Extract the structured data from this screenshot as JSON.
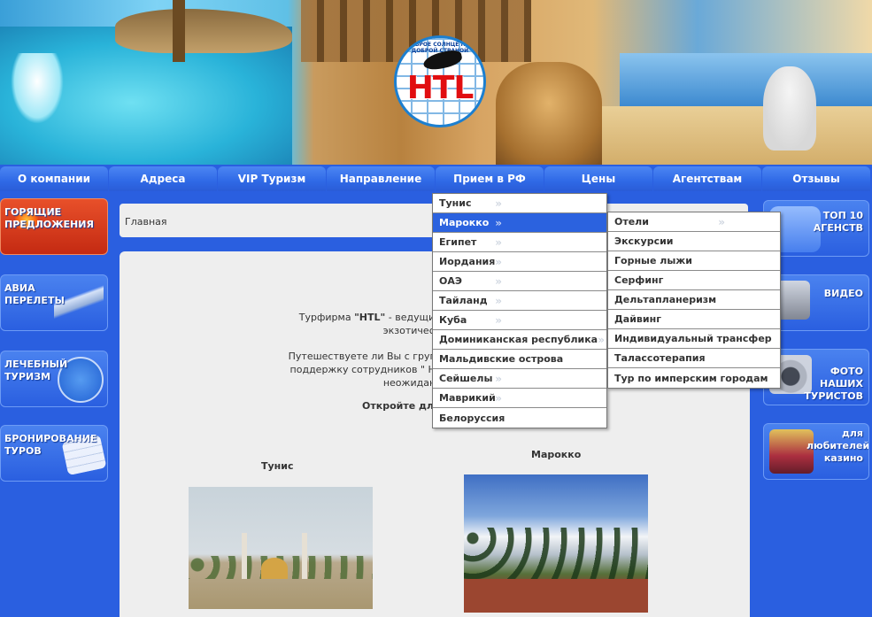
{
  "logo": {
    "text": "HTL",
    "ring_text": "ДОБРОЕ СОЛНЦЕ НАД ДОБРОЙ СТРАНОЙ"
  },
  "nav": {
    "items": [
      {
        "label": "О компании"
      },
      {
        "label": "Адреса"
      },
      {
        "label": "VIP Туризм"
      },
      {
        "label": "Направление"
      },
      {
        "label": "Прием в РФ"
      },
      {
        "label": "Цены"
      },
      {
        "label": "Агентствам"
      },
      {
        "label": "Отзывы"
      }
    ]
  },
  "left_promos": [
    {
      "title": "ГОРЯЩИЕ ПРЕДЛОЖЕНИЯ"
    },
    {
      "title": "АВИА ПЕРЕЛЕТЫ"
    },
    {
      "title": "ЛЕЧЕБНЫЙ ТУРИЗМ"
    },
    {
      "title": "БРОНИРОВАНИЕ ТУРОВ"
    }
  ],
  "right_promos": [
    {
      "title": "ТОП 10 АГЕНСТВ"
    },
    {
      "title": "ВИДЕО"
    },
    {
      "title": "ФОТО НАШИХ ТУРИСТОВ"
    },
    {
      "title": "для любителей казино"
    }
  ],
  "breadcrumb": {
    "text": "Главная"
  },
  "content": {
    "intro_line1_prefix": "Турфирма ",
    "intro_brand": "\"HTL\"",
    "intro_line1_suffix": " - ведущий тур оператор по Тунису,",
    "intro_line1b": "экзотических напра",
    "intro_line2a": "Путешествуете ли Вы с группой или индивидуально, Вы",
    "intro_line2b": "поддержку сотрудников \" HTL\". Доверив нам свой отды",
    "intro_line2c": "неожиданностей во",
    "intro_line3": "Откройте для себя новые",
    "destinations": [
      {
        "title": "Тунис"
      },
      {
        "title": "Марокко"
      }
    ]
  },
  "menu": {
    "items": [
      {
        "label": "Тунис",
        "arrow": "»"
      },
      {
        "label": "Марокко",
        "arrow": "»"
      },
      {
        "label": "Египет",
        "arrow": "»"
      },
      {
        "label": "Иордания",
        "arrow": "»"
      },
      {
        "label": "ОАЭ",
        "arrow": "»"
      },
      {
        "label": "Тайланд",
        "arrow": "»"
      },
      {
        "label": "Куба",
        "arrow": "»"
      },
      {
        "label": "Доминиканская республика",
        "arrow": "»"
      },
      {
        "label": "Мальдивские острова",
        "arrow": ""
      },
      {
        "label": "Сейшелы",
        "arrow": "»"
      },
      {
        "label": "Маврикий",
        "arrow": "»"
      },
      {
        "label": "Белоруссия",
        "arrow": ""
      }
    ],
    "active_index": 1
  },
  "submenu": {
    "items": [
      {
        "label": "Отели",
        "arrow": "»"
      },
      {
        "label": "Экскурсии",
        "arrow": ""
      },
      {
        "label": "Горные лыжи",
        "arrow": ""
      },
      {
        "label": "Серфинг",
        "arrow": ""
      },
      {
        "label": "Дельтапланеризм",
        "arrow": ""
      },
      {
        "label": "Дайвинг",
        "arrow": ""
      },
      {
        "label": "Индивидуальный трансфер",
        "arrow": ""
      },
      {
        "label": "Талассотерапия",
        "arrow": ""
      },
      {
        "label": "Тур по имперским городам",
        "arrow": ""
      }
    ]
  },
  "colors": {
    "page_blue": "#2a5fe0",
    "active_menu": "#2b62df",
    "content_bg": "#eeeeee",
    "logo_red": "#e10e10"
  }
}
